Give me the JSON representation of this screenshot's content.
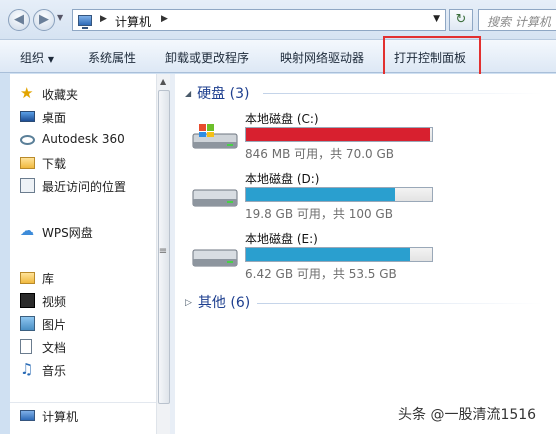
{
  "address_bar": {
    "path": [
      "计算机"
    ],
    "search_placeholder": "搜索 计算机"
  },
  "toolbar": {
    "items": [
      "组织",
      "系统属性",
      "卸载或更改程序",
      "映射网络驱动器",
      "打开控制面板"
    ],
    "highlighted_item": "打开控制面板",
    "highlight_color": "#e2302f"
  },
  "nav_pane": {
    "favorites_header": "收藏夹",
    "favorites": [
      "桌面",
      "Autodesk 360",
      "下载",
      "最近访问的位置"
    ],
    "cloud": "WPS网盘",
    "libraries_header": "库",
    "libraries": [
      "视频",
      "图片",
      "文档",
      "音乐"
    ],
    "computer": "计算机"
  },
  "content": {
    "hard_disks_header": "硬盘 (3)",
    "drives": [
      {
        "name": "本地磁盘 (C:)",
        "info": "846 MB 可用，共 70.0 GB",
        "used_fraction": 0.988,
        "bar_color": "#d8202f",
        "system": true
      },
      {
        "name": "本地磁盘 (D:)",
        "info": "19.8 GB 可用，共 100 GB",
        "used_fraction": 0.802,
        "bar_color": "#2a9fcf",
        "system": false
      },
      {
        "name": "本地磁盘 (E:)",
        "info": "6.42 GB 可用，共 53.5 GB",
        "used_fraction": 0.88,
        "bar_color": "#2a9fcf",
        "system": false
      }
    ],
    "other_header": "其他 (6)"
  },
  "watermark": "头条 @一股清流1516"
}
